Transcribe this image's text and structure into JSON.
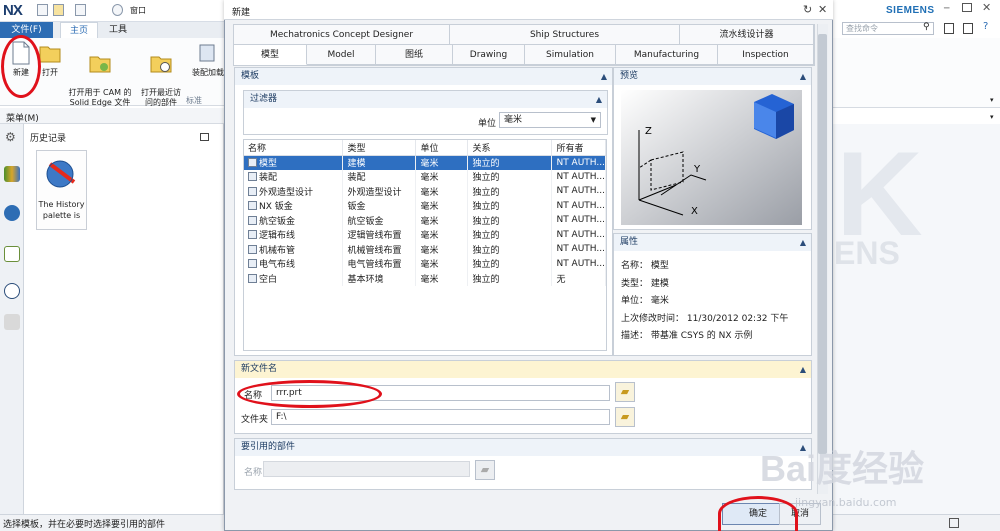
{
  "app": {
    "logo": "NX",
    "brand": "SIEMENS",
    "search_placeholder": "查找命令",
    "menu_tabs": [
      "文件(F)",
      "主页",
      "工具"
    ],
    "ribbon": {
      "buttons": [
        "新建",
        "打开",
        "打开用于 CAM 的\nSolid Edge 文件",
        "打开最近访\n问的部件",
        "装配加载"
      ],
      "group_label": "标准"
    },
    "window_menu": "窗口",
    "menu_label": "菜单(M)",
    "history": {
      "title": "历史记录",
      "palette_text": "The History palette is"
    },
    "status": "选择模板，并在必要时选择要引用的部件",
    "watermark": "Bai度经验",
    "watermark_url": "jingyan.baidu.com"
  },
  "dialog": {
    "title": "新建",
    "tabs_row1": [
      "Mechatronics Concept Designer",
      "Ship Structures",
      "流水线设计器"
    ],
    "tabs_row2": [
      "模型",
      "Model",
      "图纸",
      "Drawing",
      "Simulation",
      "Manufacturing",
      "Inspection"
    ],
    "active_tab": "模型",
    "templates": {
      "title": "模板",
      "filter_title": "过滤器",
      "unit_label": "单位",
      "unit_value": "毫米",
      "columns": [
        "名称",
        "类型",
        "单位",
        "关系",
        "所有者"
      ],
      "rows": [
        [
          "模型",
          "建模",
          "毫米",
          "独立的",
          "NT AUTH..."
        ],
        [
          "装配",
          "装配",
          "毫米",
          "独立的",
          "NT AUTH..."
        ],
        [
          "外观造型设计",
          "外观造型设计",
          "毫米",
          "独立的",
          "NT AUTH..."
        ],
        [
          "NX 钣金",
          "钣金",
          "毫米",
          "独立的",
          "NT AUTH..."
        ],
        [
          "航空钣金",
          "航空钣金",
          "毫米",
          "独立的",
          "NT AUTH..."
        ],
        [
          "逻辑布线",
          "逻辑管线布置",
          "毫米",
          "独立的",
          "NT AUTH..."
        ],
        [
          "机械布管",
          "机械管线布置",
          "毫米",
          "独立的",
          "NT AUTH..."
        ],
        [
          "电气布线",
          "电气管线布置",
          "毫米",
          "独立的",
          "NT AUTH..."
        ],
        [
          "空白",
          "基本环境",
          "毫米",
          "独立的",
          "无"
        ]
      ]
    },
    "preview": {
      "title": "预览"
    },
    "properties": {
      "title": "属性",
      "lines": [
        "名称： 模型",
        "类型： 建模",
        "单位： 毫米",
        "上次修改时间： 11/30/2012 02:32 下午",
        "描述： 带基准 CSYS 的 NX 示例"
      ]
    },
    "new_file": {
      "title": "新文件名",
      "name_label": "名称",
      "name_value": "rrr.prt",
      "folder_label": "文件夹",
      "folder_value": "F:\\"
    },
    "reference": {
      "title": "要引用的部件",
      "name_label": "名称"
    },
    "ok_label": "确定",
    "cancel_label": "取消"
  }
}
